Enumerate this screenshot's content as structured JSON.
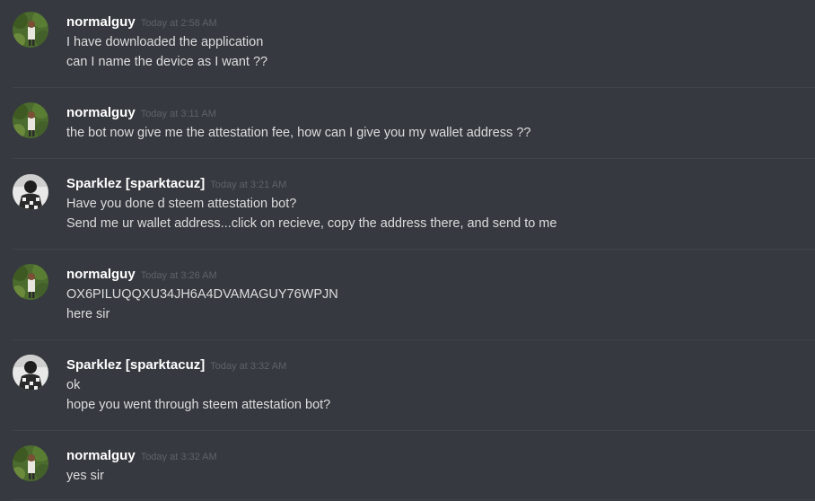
{
  "messages": [
    {
      "author": "normalguy",
      "avatar": "normalguy-avatar",
      "time": "Today at 2:58 AM",
      "lines": [
        "I have downloaded the application",
        "can I name the device as I want ??"
      ]
    },
    {
      "author": "normalguy",
      "avatar": "normalguy-avatar",
      "time": "Today at 3:11 AM",
      "lines": [
        "the bot now give me the attestation fee, how can I give you my wallet address ??"
      ]
    },
    {
      "author": "Sparklez [sparktacuz]",
      "avatar": "sparklez-avatar",
      "time": "Today at 3:21 AM",
      "lines": [
        "Have you done d steem attestation bot?",
        "Send me ur wallet address...click on recieve, copy the address there, and send to me"
      ]
    },
    {
      "author": "normalguy",
      "avatar": "normalguy-avatar",
      "time": "Today at 3:26 AM",
      "lines": [
        "OX6PILUQQXU34JH6A4DVAMAGUY76WPJN",
        "here sir"
      ]
    },
    {
      "author": "Sparklez [sparktacuz]",
      "avatar": "sparklez-avatar",
      "time": "Today at 3:32 AM",
      "lines": [
        "ok",
        "hope you went through steem attestation bot?"
      ]
    },
    {
      "author": "normalguy",
      "avatar": "normalguy-avatar",
      "time": "Today at 3:32 AM",
      "lines": [
        "yes sir"
      ]
    }
  ],
  "colors": {
    "background": "#36393f",
    "username": "#ffffff",
    "timestamp": "#5f6268",
    "text": "#dcddde"
  }
}
